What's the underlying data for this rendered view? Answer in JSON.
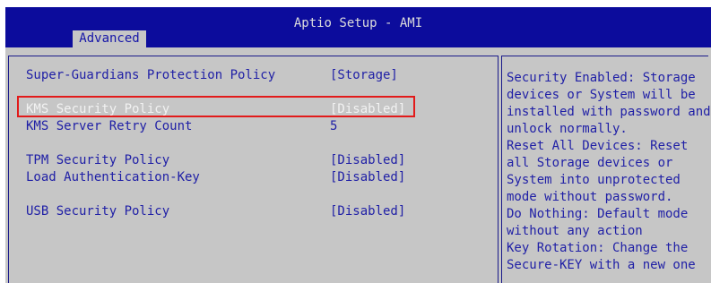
{
  "window": {
    "title": "Aptio Setup - AMI"
  },
  "tabs": [
    {
      "label": "Advanced"
    }
  ],
  "settings": [
    {
      "label": "Super-Guardians Protection Policy",
      "value": "[Storage]"
    },
    {
      "label": "KMS Security Policy",
      "value": "[Disabled]"
    },
    {
      "label": "KMS Server Retry Count",
      "value": "5"
    },
    {
      "label": "TPM Security Policy",
      "value": "[Disabled]"
    },
    {
      "label": "Load Authentication-Key",
      "value": "[Disabled]"
    },
    {
      "label": "USB Security Policy",
      "value": "[Disabled]"
    }
  ],
  "help": {
    "lines": [
      "Security Enabled: Storage",
      "devices or System will be",
      "installed with password and",
      "unlock normally.",
      "Reset All Devices: Reset",
      "all Storage devices or",
      "System into unprotected",
      "mode without password.",
      "Do Nothing: Default mode",
      "without any action",
      "Key Rotation: Change the",
      "Secure-KEY with a new one"
    ]
  },
  "colors": {
    "header_bg": "#0c0c9c",
    "body_bg": "#c6c6c6",
    "text_blue": "#1f1fa6",
    "selected_text": "#f2f2f2",
    "highlight_border": "#e21a1a"
  }
}
